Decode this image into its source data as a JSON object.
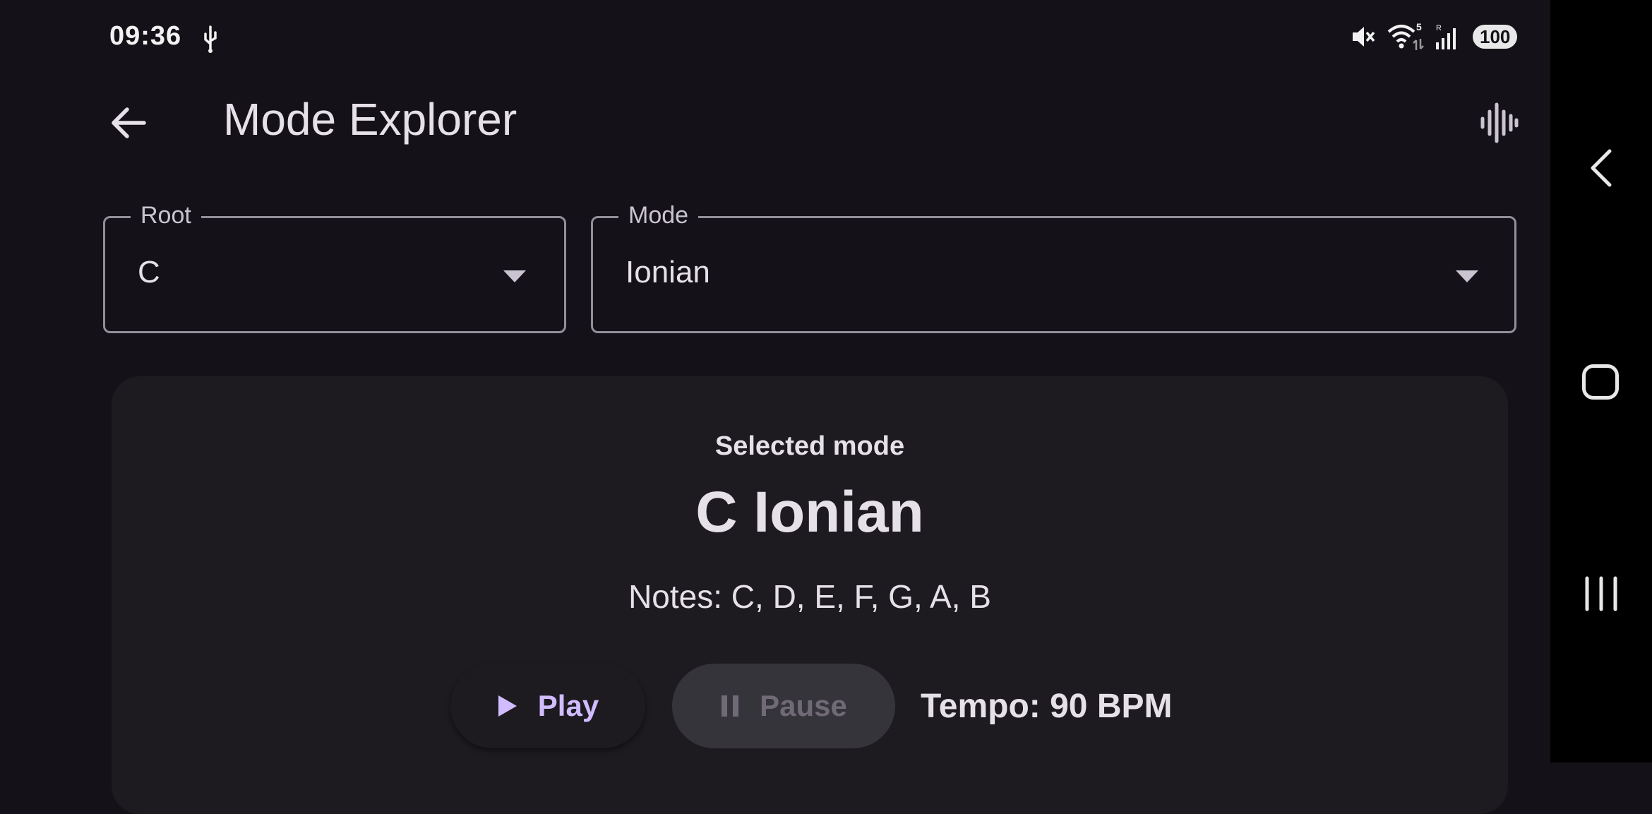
{
  "status_bar": {
    "time": "09:36",
    "battery": "100",
    "wifi_badge": "5",
    "icons": [
      "usb-icon",
      "mute-icon",
      "wifi-icon",
      "signal-icon",
      "battery-icon"
    ]
  },
  "app_bar": {
    "title": "Mode Explorer",
    "back_icon": "arrow-back-icon",
    "action_icon": "waveform-icon"
  },
  "root_field": {
    "label": "Root",
    "value": "C"
  },
  "mode_field": {
    "label": "Mode",
    "value": "Ionian"
  },
  "card": {
    "label": "Selected mode",
    "title": "C Ionian",
    "notes": "Notes: C, D, E, F, G, A, B",
    "play_label": "Play",
    "pause_label": "Pause",
    "tempo": "Tempo: 90 BPM"
  },
  "colors": {
    "background": "#141218",
    "surface": "#1d1b20",
    "accent": "#d0bcff",
    "disabled": "#6f6a75"
  },
  "nav_bar": {
    "icons": [
      "nav-back-icon",
      "nav-home-icon",
      "nav-recents-icon"
    ]
  }
}
